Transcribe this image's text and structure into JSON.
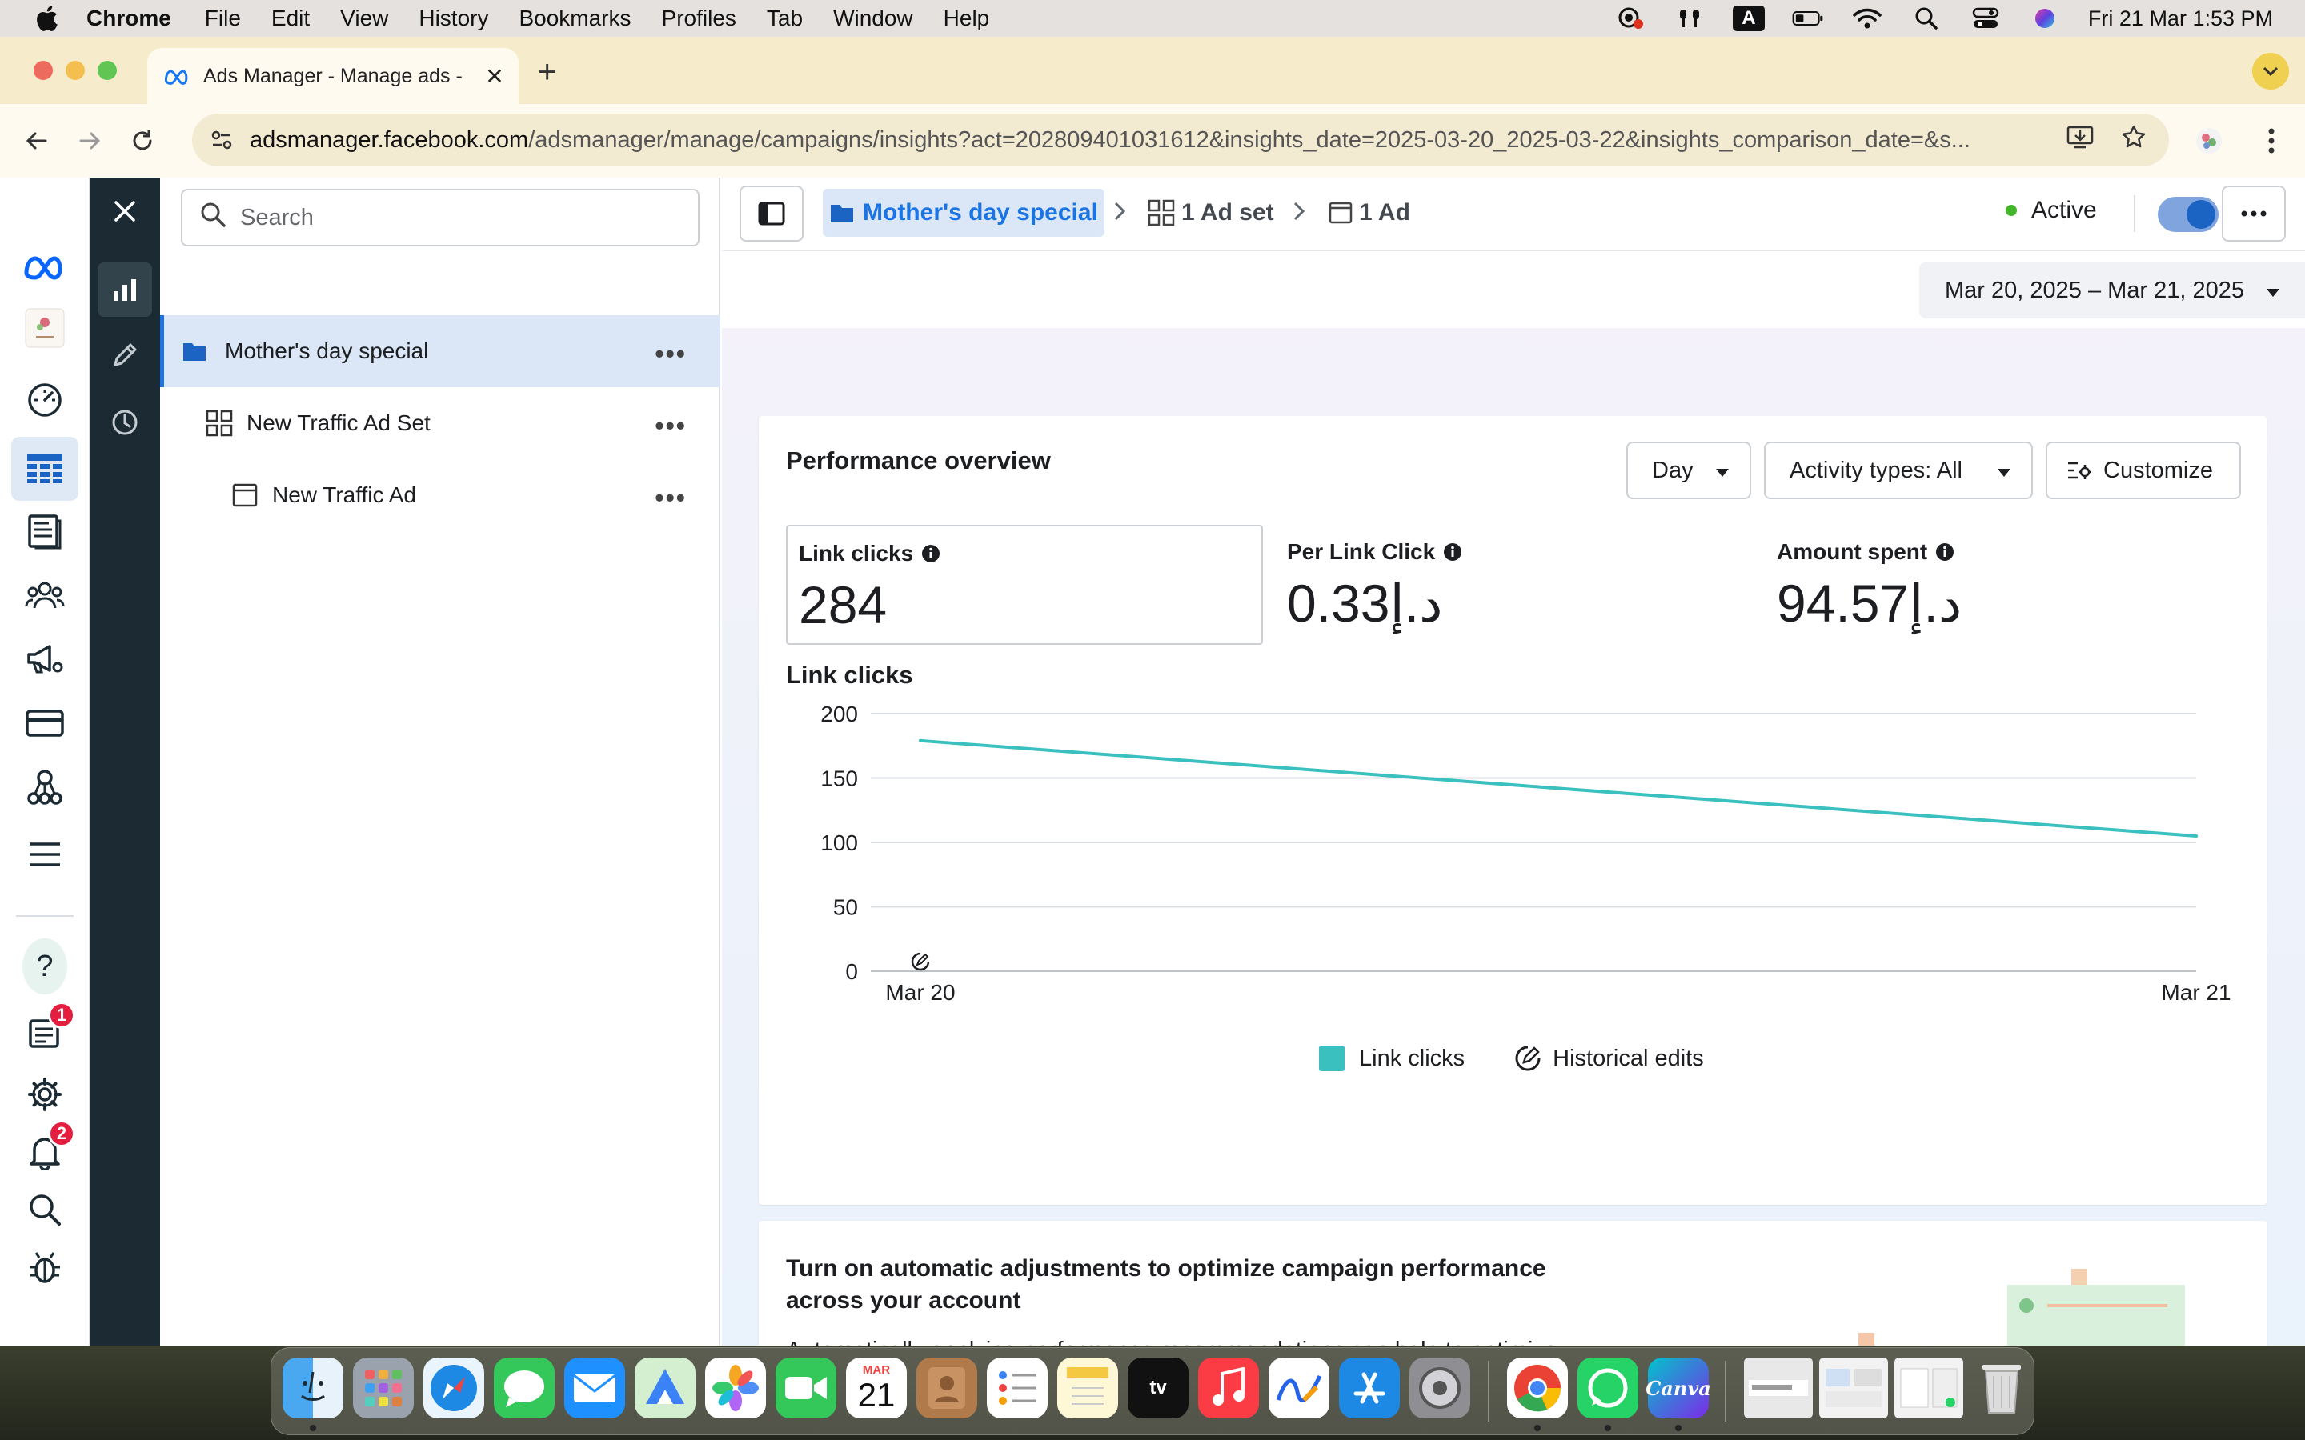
{
  "menubar": {
    "app": "Chrome",
    "items": [
      "File",
      "Edit",
      "View",
      "History",
      "Bookmarks",
      "Profiles",
      "Tab",
      "Window",
      "Help"
    ],
    "datetime": "Fri 21 Mar  1:53 PM",
    "input_source": "A"
  },
  "browser": {
    "tab_title": "Ads Manager - Manage ads -",
    "url_host": "adsmanager.facebook.com",
    "url_path": "/adsmanager/manage/campaigns/insights?act=202809401031612&insights_date=2025-03-20_2025-03-22&insights_comparison_date=&s..."
  },
  "nav": {
    "badges": {
      "notifications_page": "1",
      "alerts": "2"
    },
    "help_label": "?"
  },
  "tree": {
    "search_placeholder": "Search",
    "items": [
      {
        "label": "Mother's day special",
        "level": "campaign"
      },
      {
        "label": "New Traffic Ad Set",
        "level": "adset"
      },
      {
        "label": "New Traffic Ad",
        "level": "ad"
      }
    ]
  },
  "topbar": {
    "campaign": "Mother's day special",
    "adset_crumb": "1 Ad set",
    "ad_crumb": "1 Ad",
    "status": "Active",
    "date_range": "Mar 20, 2025 – Mar 21, 2025"
  },
  "performance": {
    "title": "Performance overview",
    "day_label": "Day",
    "activity_label": "Activity types: All",
    "customize_label": "Customize",
    "metrics": [
      {
        "label": "Link clicks",
        "value": "284"
      },
      {
        "label": "Per Link Click",
        "value": "0.33د.إ"
      },
      {
        "label": "Amount spent",
        "value": "94.57د.إ"
      }
    ],
    "chart_title": "Link clicks",
    "legend_series": "Link clicks",
    "legend_edits": "Historical edits"
  },
  "chart_data": {
    "type": "line",
    "title": "Link clicks",
    "x": [
      "Mar 20",
      "Mar 21"
    ],
    "series": [
      {
        "name": "Link clicks",
        "values": [
          179,
          105
        ]
      }
    ],
    "yticks": [
      0,
      50,
      100,
      150,
      200
    ],
    "ylim": [
      0,
      200
    ],
    "grid": true,
    "legend": "bottom",
    "line_color": "#3bc0c0"
  },
  "promo": {
    "title": "Turn on automatic adjustments to optimize campaign performance across your account",
    "body": "Automatically applying performance recommendations can help to optimize your campaign performance. You can choose which adjustments"
  },
  "dock": {
    "calendar_month": "MAR",
    "calendar_day": "21",
    "tv_label": "tv",
    "canva_label": "Canva"
  },
  "colors": {
    "accent": "#1b74e4",
    "active_status": "#42b72a",
    "chart_line": "#3bc0c0",
    "badge": "#e41e3f"
  }
}
